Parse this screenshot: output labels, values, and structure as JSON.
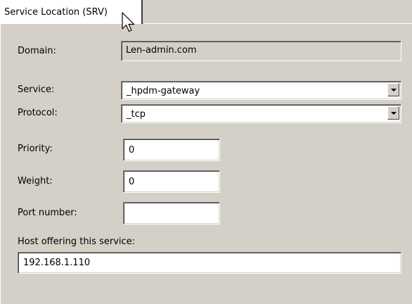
{
  "tab": {
    "label": "Service Location (SRV)"
  },
  "form": {
    "domain_label": "Domain:",
    "domain_value": "Len-admin.com",
    "service_label": "Service:",
    "service_value": "_hpdm-gateway",
    "protocol_label": "Protocol:",
    "protocol_value": "_tcp",
    "priority_label": "Priority:",
    "priority_value": "0",
    "weight_label": "Weight:",
    "weight_value": "0",
    "port_label": "Port number:",
    "port_value": "",
    "host_label": "Host offering this service:",
    "host_value": "192.168.1.110"
  },
  "icons": {
    "combo_arrow": "chevron-down-icon",
    "cursor": "mouse-pointer-icon"
  }
}
